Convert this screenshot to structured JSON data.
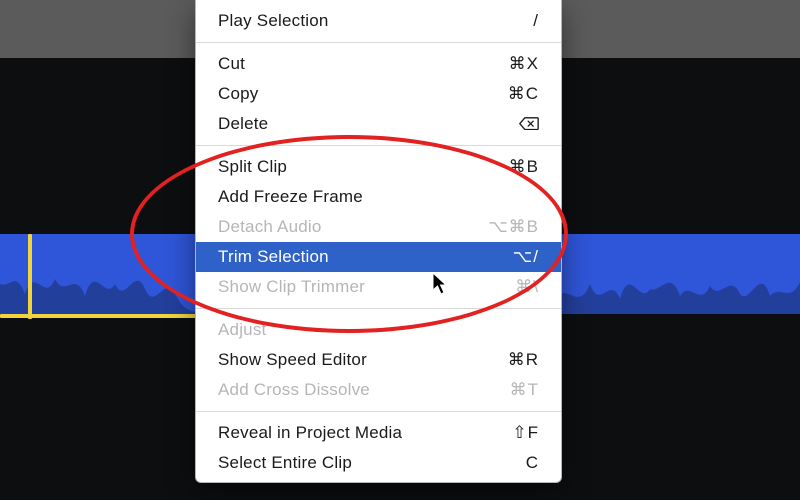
{
  "menu": {
    "play_selection": {
      "label": "Play Selection",
      "shortcut": "/"
    },
    "cut": {
      "label": "Cut",
      "shortcut": "⌘X"
    },
    "copy": {
      "label": "Copy",
      "shortcut": "⌘C"
    },
    "delete": {
      "label": "Delete"
    },
    "split_clip": {
      "label": "Split Clip",
      "shortcut": "⌘B"
    },
    "add_freeze_frame": {
      "label": "Add Freeze Frame"
    },
    "detach_audio": {
      "label": "Detach Audio",
      "shortcut": "⌥⌘B"
    },
    "trim_selection": {
      "label": "Trim Selection",
      "shortcut": "⌥/"
    },
    "show_clip_trimmer": {
      "label": "Show Clip Trimmer",
      "shortcut": "⌘\\"
    },
    "adjust": {
      "label": "Adjust"
    },
    "show_speed_editor": {
      "label": "Show Speed Editor",
      "shortcut": "⌘R"
    },
    "add_cross_dissolve": {
      "label": "Add Cross Dissolve",
      "shortcut": "⌘T"
    },
    "reveal_in_project": {
      "label": "Reveal in Project Media",
      "shortcut": "⇧F"
    },
    "select_entire_clip": {
      "label": "Select Entire Clip",
      "shortcut": "C"
    }
  },
  "annotation": {
    "highlight_color": "#e22121"
  },
  "timeline": {
    "waveform_color": "#223a8f",
    "clip_color": "#2f55d8",
    "playhead_color": "#f1d43c"
  }
}
